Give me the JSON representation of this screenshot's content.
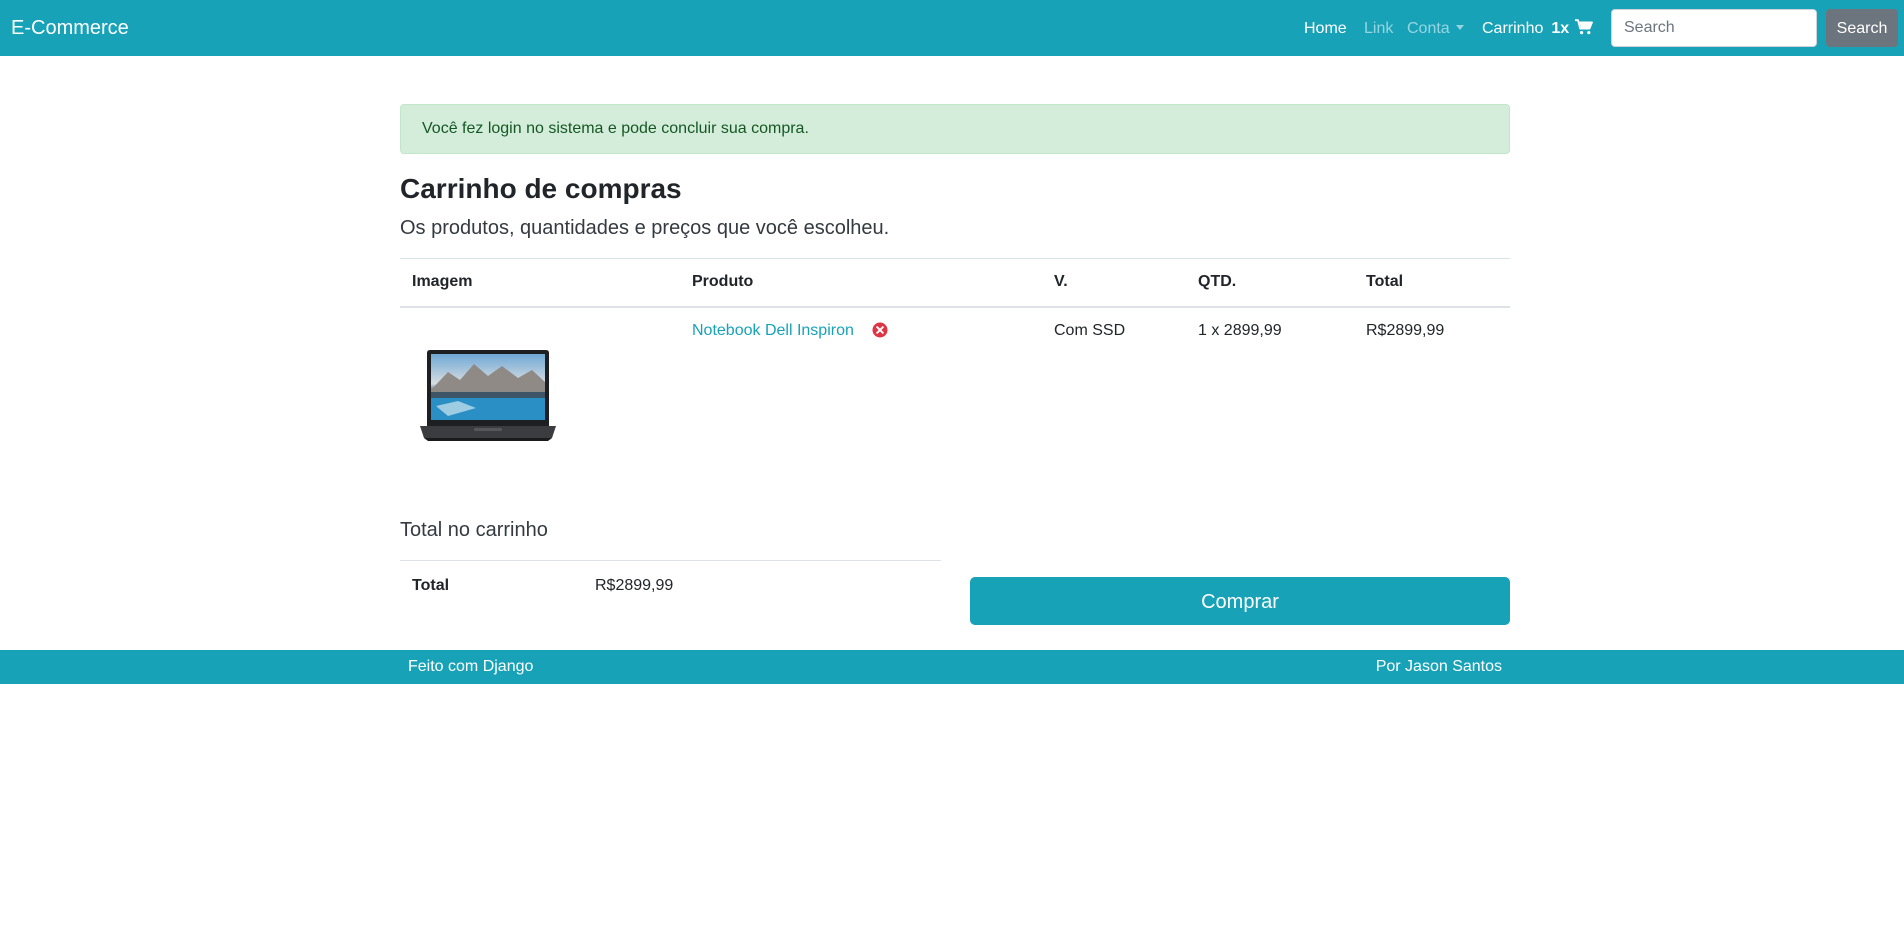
{
  "navbar": {
    "brand": "E-Commerce",
    "links": [
      {
        "label": "Home",
        "active": true
      },
      {
        "label": "Link",
        "active": false
      },
      {
        "label": "Conta",
        "active": false,
        "dropdown": true
      }
    ],
    "cart": {
      "label": "Carrinho",
      "count": "1x",
      "icon": "shopping-cart-icon"
    },
    "search": {
      "placeholder": "Search",
      "value": "",
      "button_label": "Search"
    }
  },
  "alert": {
    "type": "success",
    "message": "Você fez login no sistema e pode concluir sua compra."
  },
  "page": {
    "title": "Carrinho de compras",
    "lead": "Os produtos, quantidades e preços que você escolheu."
  },
  "cart_table": {
    "headers": [
      "Imagem",
      "Produto",
      "V.",
      "QTD.",
      "Total"
    ],
    "rows": [
      {
        "image": "laptop-image",
        "product": "Notebook Dell Inspiron",
        "remove_icon": "remove-circle-icon",
        "variation": "Com SSD",
        "quantity": "1 x 2899,99",
        "total": "R$2899,99"
      }
    ]
  },
  "totals": {
    "heading": "Total no carrinho",
    "label": "Total",
    "value": "R$2899,99"
  },
  "buy_button": "Comprar",
  "footer": {
    "left": "Feito com Django",
    "right": "Por Jason Santos"
  },
  "colors": {
    "primary": "#17a2b8",
    "success_bg": "#d4edda",
    "success_text": "#155724",
    "danger": "#dc3545",
    "secondary": "#6c757d"
  }
}
